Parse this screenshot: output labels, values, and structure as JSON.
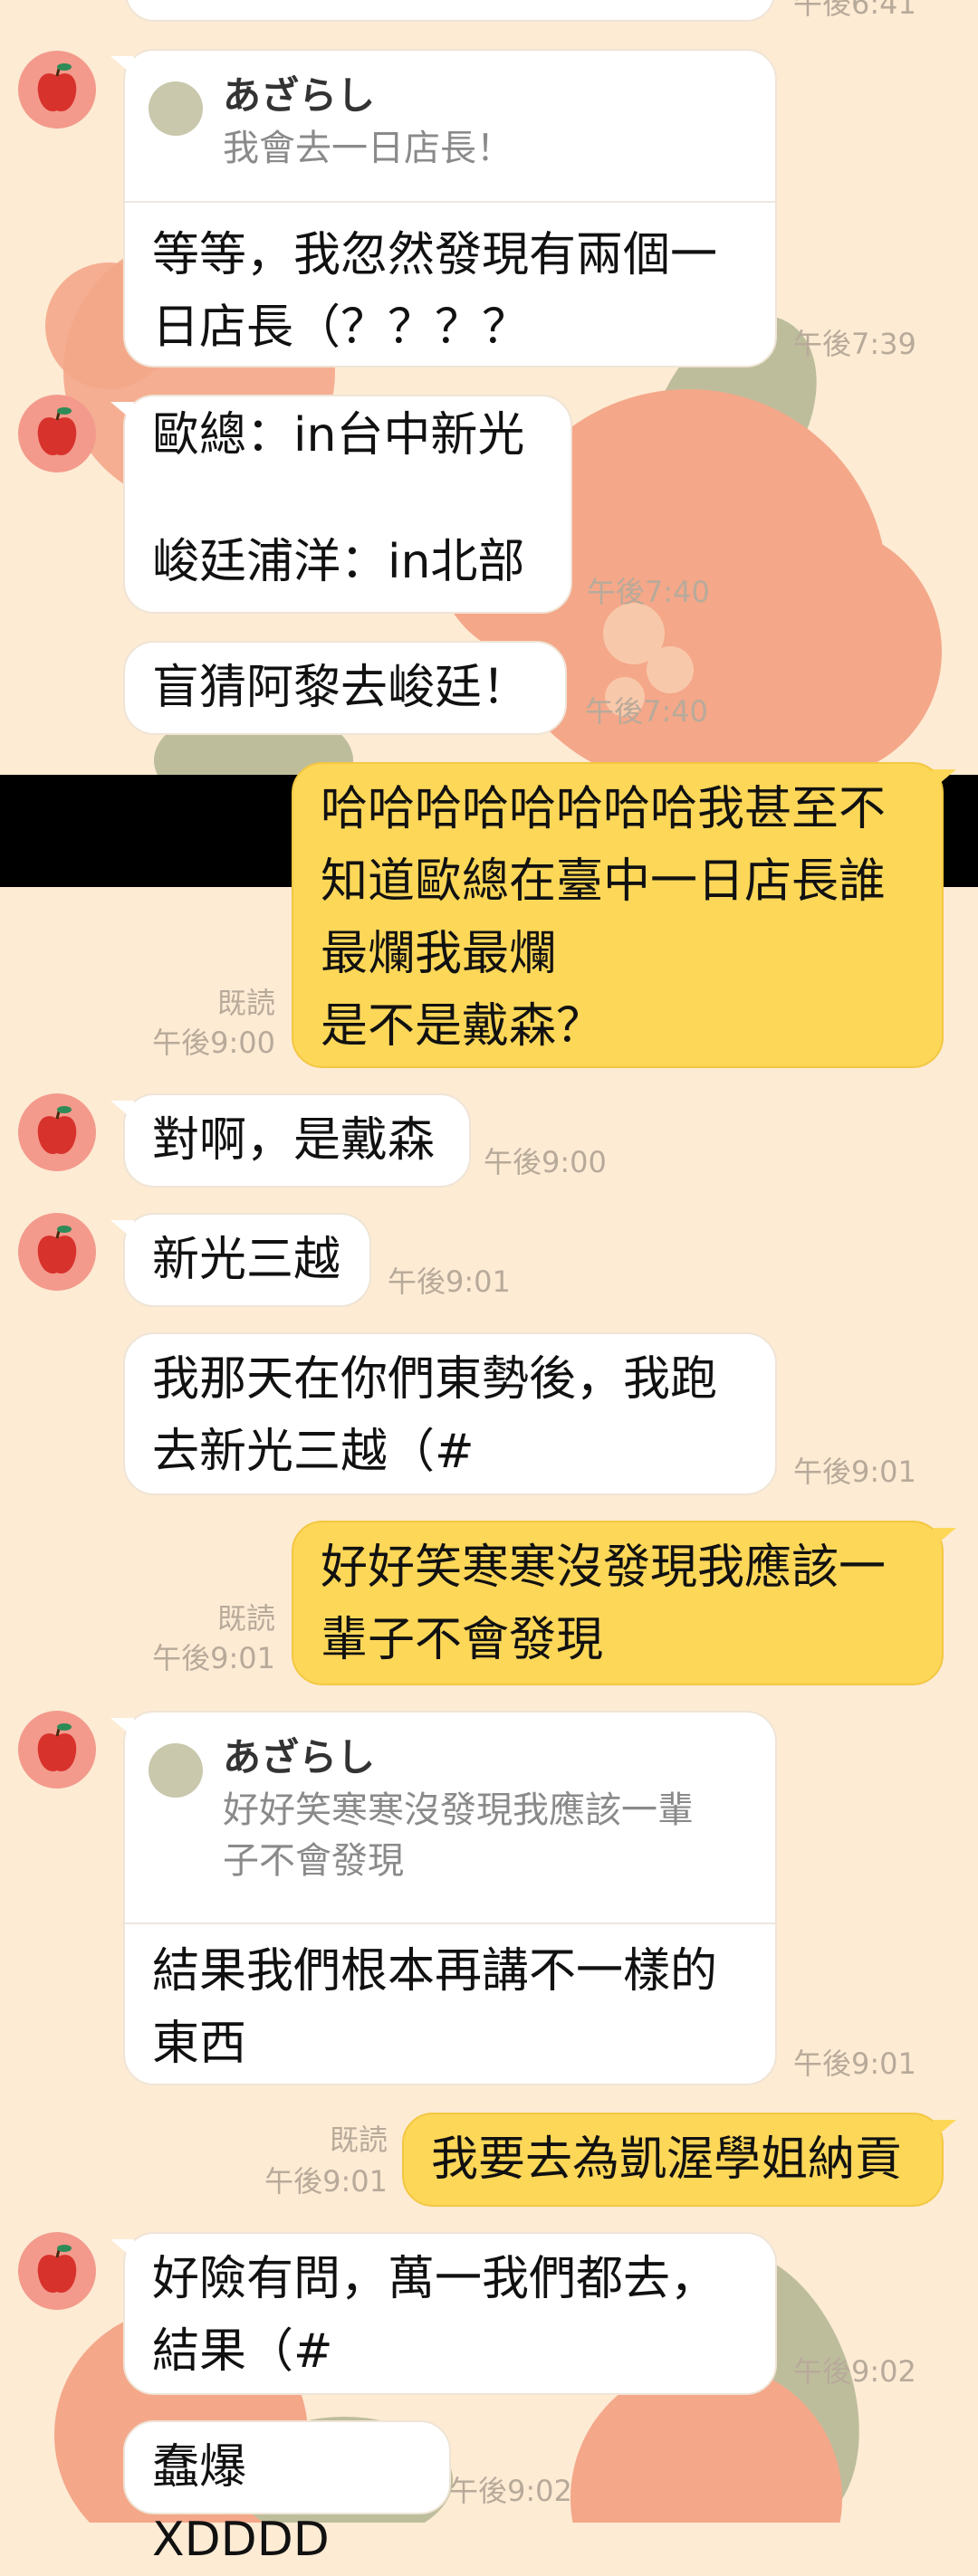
{
  "colors": {
    "background": "#fdebd4",
    "incoming_bubble": "#ffffff",
    "outgoing_bubble": "#fdd758",
    "timestamp": "#b8aa9a"
  },
  "top_partial_time": "午後6:41",
  "avatar_icon": "apple-icon",
  "messages": [
    {
      "type": "in",
      "quote_name": "あざらし",
      "quote_text": "我會去一日店長！",
      "text": "等等，我忽然發現有兩個一\n日店長（？？？？",
      "time": "午後7:39"
    },
    {
      "type": "in",
      "text": "歐總：in台中新光\n\n峻廷浦洋：in北部",
      "time": "午後7:40"
    },
    {
      "type": "in",
      "text": "盲猜阿黎去峻廷！",
      "time": "午後7:40"
    },
    {
      "type": "out",
      "text": "哈哈哈哈哈哈哈哈我甚至不\n知道歐總在臺中一日店長誰\n最爛我最爛\n是不是戴森？",
      "read": "既読",
      "time": "午後9:00"
    },
    {
      "type": "in",
      "text": "對啊，是戴森",
      "time": "午後9:00"
    },
    {
      "type": "in",
      "text": "新光三越",
      "time": "午後9:01"
    },
    {
      "type": "in",
      "text": "我那天在你們東勢後，我跑\n去新光三越（#",
      "time": "午後9:01"
    },
    {
      "type": "out",
      "text": "好好笑寒寒沒發現我應該一\n輩子不會發現",
      "read": "既読",
      "time": "午後9:01"
    },
    {
      "type": "in",
      "quote_name": "あざらし",
      "quote_text": "好好笑寒寒沒發現我應該一輩\n子不會發現",
      "text": "結果我們根本再講不一樣的\n東西",
      "time": "午後9:01"
    },
    {
      "type": "out",
      "text": "我要去為凱渥學姐納貢",
      "read": "既読",
      "time": "午後9:01"
    },
    {
      "type": "in",
      "text": "好險有問，萬一我們都去，\n結果（#",
      "time": "午後9:02"
    },
    {
      "type": "in",
      "text": "蠢爆XDDDD",
      "time": "午後9:02"
    }
  ]
}
